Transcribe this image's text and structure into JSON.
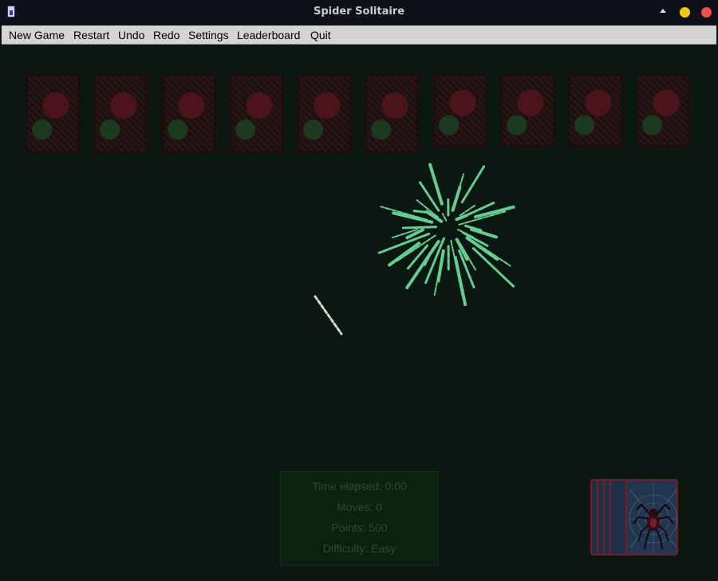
{
  "window": {
    "title": "Spider Solitaire"
  },
  "menu": [
    "New Game",
    "Restart",
    "Undo",
    "Redo",
    "Settings",
    "Leaderboard",
    "Quit"
  ],
  "tableau": {
    "columns": 10
  },
  "stats": {
    "time": "Time elapsed: 0:00",
    "moves": "Moves: 0",
    "points": "Points: 500",
    "difficulty": "Difficulty: Easy"
  },
  "stock": {
    "piles": 5
  },
  "colors": {
    "felt": "#0b1812",
    "firework": "#6fe0a0",
    "menubar": "#d4d4d4"
  }
}
